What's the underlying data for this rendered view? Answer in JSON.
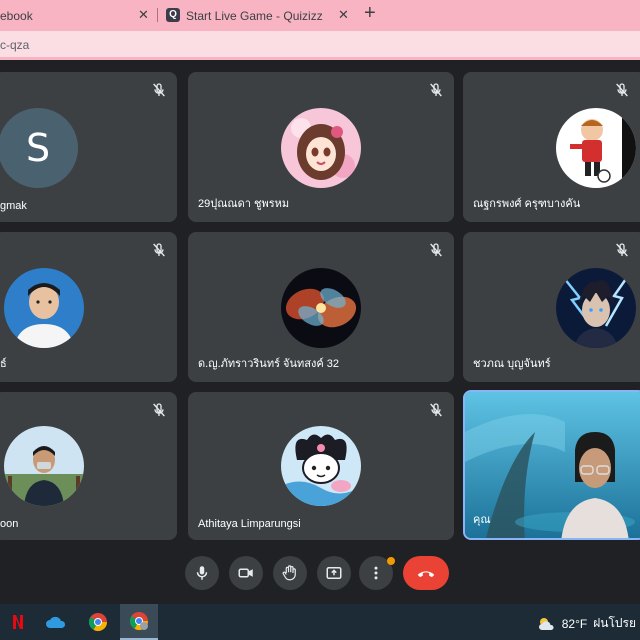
{
  "browser": {
    "tabs": [
      {
        "title": "ebook",
        "close": "✕"
      },
      {
        "title": "Start Live Game - Quizizz",
        "favicon": "Q",
        "close": "✕"
      }
    ],
    "new_tab": "+",
    "url": "c-qza"
  },
  "participants": [
    {
      "name": "gmak",
      "avatar": "letter-S",
      "initial": "S",
      "muted": true
    },
    {
      "name": "29ปุณณดา ชูพรหม",
      "avatar": "anime-girl",
      "muted": true
    },
    {
      "name": "ณฐกรพงศ์ ครุฑบางคัน",
      "avatar": "soccer-cartoon",
      "muted": true
    },
    {
      "name": "ธ์",
      "avatar": "boy-photo",
      "muted": true
    },
    {
      "name": "ด.ญ.ภัทราวรินทร์ จันทสงค์ 32",
      "avatar": "nebula",
      "muted": true
    },
    {
      "name": "ชวภณ บุญจันทร์",
      "avatar": "lightning-anime",
      "muted": true
    },
    {
      "name": "oon",
      "avatar": "man-outdoor",
      "muted": true
    },
    {
      "name": "Athitaya Limparungsi",
      "avatar": "kuromi",
      "muted": true
    },
    {
      "name": "คุณ",
      "avatar": "self-video",
      "muted": false
    }
  ],
  "controls": [
    "microphone-icon",
    "camera-icon",
    "raise-hand-icon",
    "present-icon",
    "more-options-icon",
    "end-call-icon"
  ],
  "taskbar": {
    "apps": [
      "netflix-icon",
      "onedrive-icon",
      "chrome-icon",
      "chrome-profile-icon"
    ],
    "weather": {
      "temp": "82°F",
      "condition": "ฝนโปรย"
    }
  },
  "colors": {
    "tab_strip": "#f8b4c3",
    "tile": "#3c4043",
    "hangup": "#ea4335",
    "self_border": "#8ab4f8"
  }
}
